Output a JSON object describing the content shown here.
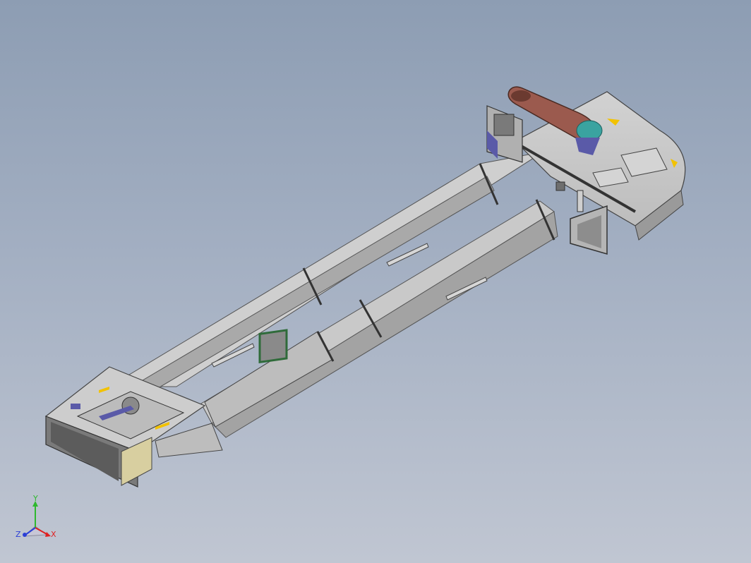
{
  "viewport": {
    "background_top": "#8d9db3",
    "background_bottom": "#c0c6d2"
  },
  "model": {
    "kind": "bucket elevator assembly (isometric view)",
    "colors": {
      "casing": "#c8c8c8",
      "casing_shadow": "#9a9a9a",
      "casing_dark": "#6e6e6e",
      "belt_guard": "#9b5a4e",
      "gearbox": "#3aa3a0",
      "bracket": "#5a5aa8",
      "arrow": "#f2c200",
      "access_door": "#d8cfa0"
    }
  },
  "triad": {
    "y_label": "Y",
    "z_label": "Z",
    "x_label": "X",
    "y_color": "#2eb82e",
    "z_color": "#2b3fd6",
    "x_color": "#e02020"
  }
}
